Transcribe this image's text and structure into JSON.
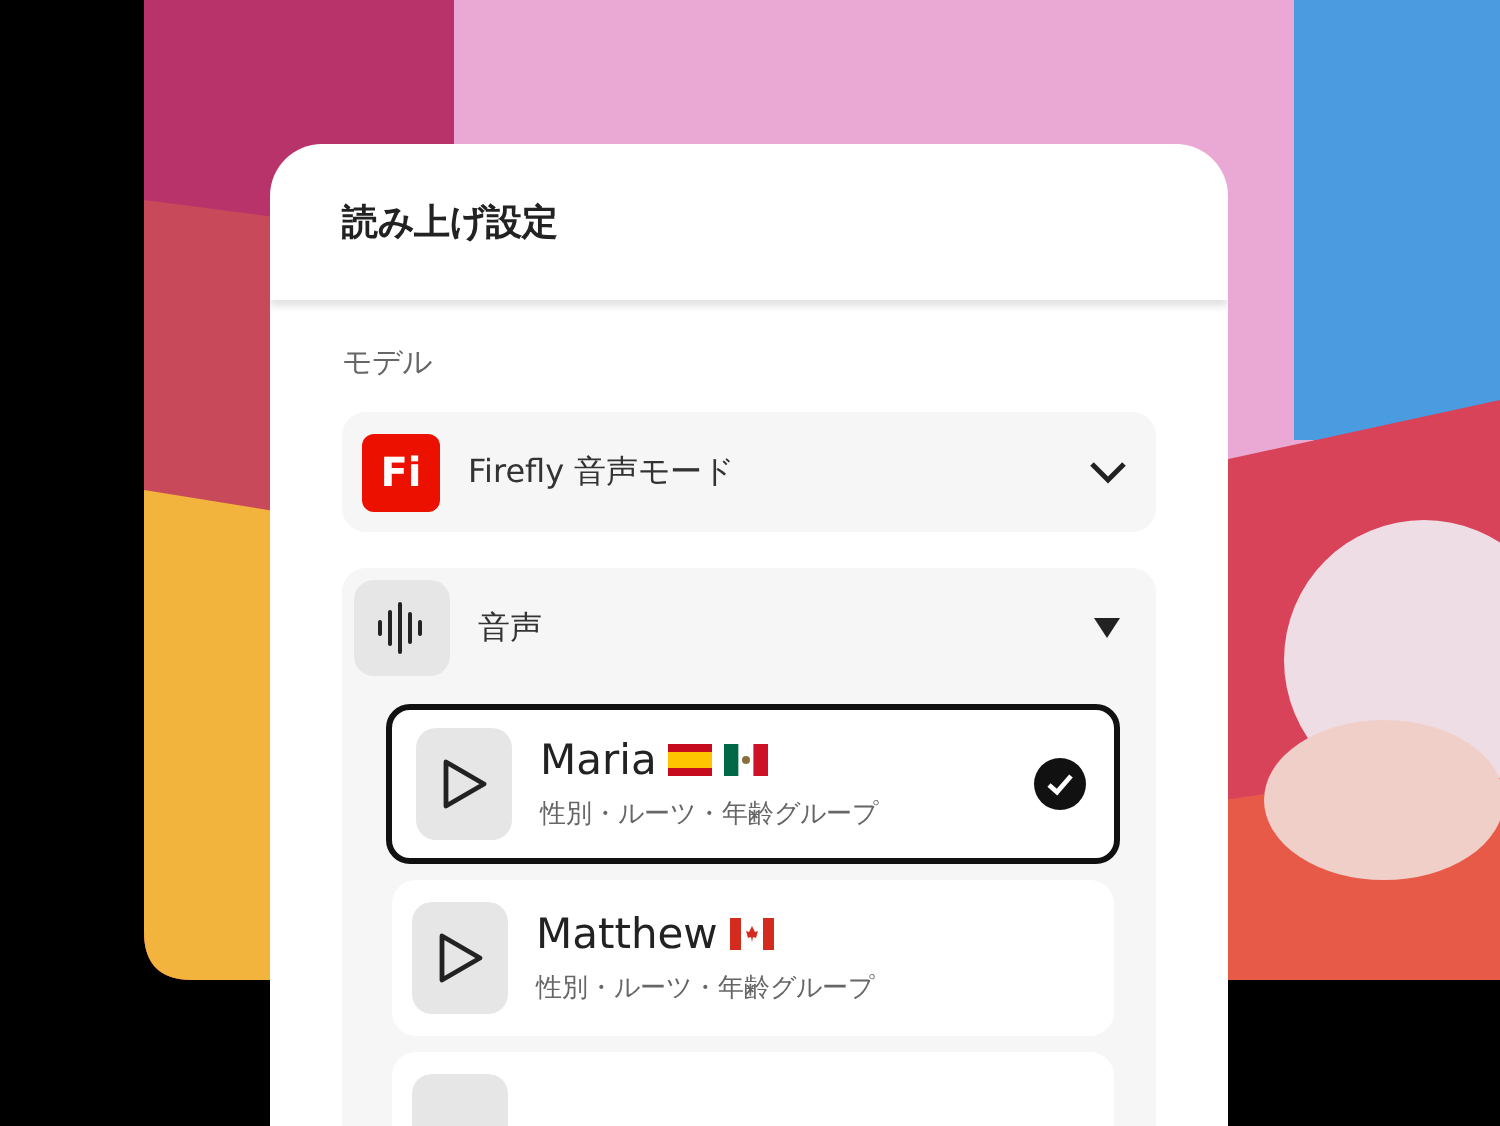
{
  "dialog": {
    "title": "読み上げ設定"
  },
  "model": {
    "label": "モデル",
    "app_badge": "Fi",
    "value": "Firefly 音声モード",
    "expanded": false
  },
  "voice": {
    "label": "音声",
    "expanded": true,
    "options": [
      {
        "name": "Maria",
        "flags": [
          {
            "kind": "spain"
          },
          {
            "kind": "mexico"
          }
        ],
        "description": "性別・ルーツ・年齢グループ",
        "selected": true
      },
      {
        "name": "Matthew",
        "flags": [
          {
            "kind": "canada"
          }
        ],
        "description": "性別・ルーツ・年齢グループ",
        "selected": false
      }
    ]
  }
}
